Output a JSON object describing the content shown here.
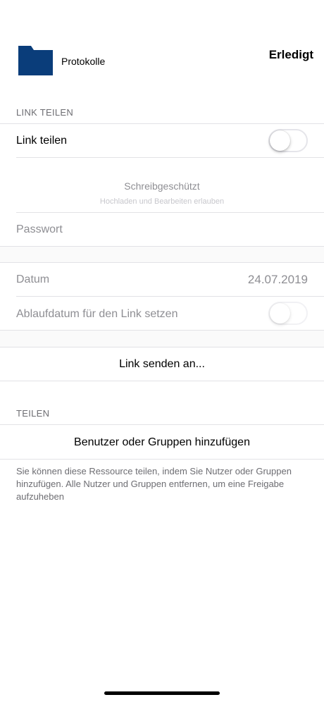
{
  "header": {
    "folder_name": "Protokolle",
    "done_label": "Erledigt",
    "folder_icon": "folder-icon",
    "folder_color": "#0a3d7a"
  },
  "link_section": {
    "header": "LINK TEILEN",
    "share_link_label": "Link teilen",
    "share_link_on": false,
    "permission_title": "Schreibgeschützt",
    "permission_subtitle": "Hochladen und Bearbeiten erlauben",
    "password_placeholder": "Passwort",
    "date_label": "Datum",
    "date_value": "24.07.2019",
    "expiry_label": "Ablaufdatum für den Link setzen",
    "expiry_on": false,
    "send_link_label": "Link senden an..."
  },
  "share_section": {
    "header": "TEILEN",
    "add_label": "Benutzer oder Gruppen hinzufügen",
    "footnote": "Sie können diese Ressource teilen, indem Sie Nutzer oder Gruppen hinzufügen. Alle Nutzer und Gruppen entfernen, um eine Freigabe aufzuheben"
  },
  "colors": {
    "accent": "#0a3d7a",
    "secondary_text": "#6d6d72",
    "disabled_text": "#8e8e93"
  }
}
